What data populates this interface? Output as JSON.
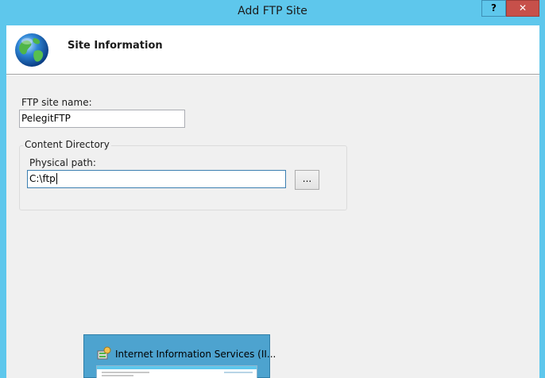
{
  "window": {
    "title": "Add FTP Site",
    "help_label": "?",
    "close_label": "✕"
  },
  "header": {
    "title": "Site Information",
    "icon": "globe-icon"
  },
  "form": {
    "site_name_label": "FTP site name:",
    "site_name_value": "PelegitFTP",
    "content_directory": {
      "title": "Content Directory",
      "physical_path_label": "Physical path:",
      "physical_path_value": "C:\\ftp",
      "browse_label": "..."
    }
  },
  "taskbar_thumbnail": {
    "title": "Internet Information Services (II...",
    "icon": "iis-icon"
  },
  "colors": {
    "titlebar": "#5ec7ec",
    "close_button": "#c7504a",
    "dialog_body": "#f0f0f0"
  }
}
